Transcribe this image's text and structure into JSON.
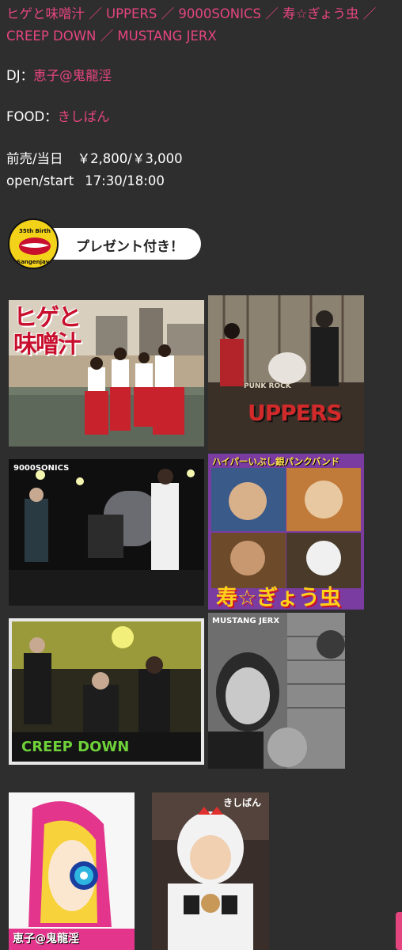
{
  "lineup": {
    "bands": [
      "ヒゲと味噌汁",
      "UPPERS",
      "9000SONICS",
      "寿☆ぎょう虫",
      "CREEP DOWN",
      "MUSTANG JERX"
    ],
    "separator": "／"
  },
  "dj": {
    "label": "DJ：",
    "name": "恵子@鬼龍淫"
  },
  "food": {
    "label": "FOOD：",
    "name": "きしばん"
  },
  "price": {
    "label": "前売/当日",
    "value": "￥2,800/￥3,000"
  },
  "time": {
    "label": "open/start",
    "value": "17:30/18:00"
  },
  "present_badge": {
    "text": "プレゼント付き！",
    "logo_top": "35th Birth",
    "logo_bottom": "Sangenjaya"
  },
  "photos": {
    "higeto": {
      "caption": "ヒゲと味噌汁"
    },
    "uppers": {
      "caption": "UPPERS",
      "subcaption": "PUNK ROCK"
    },
    "sonics": {
      "caption": "9000SONICS"
    },
    "kotobuki": {
      "caption": "寿☆ぎょう虫",
      "top_caption": "ハイパーいぶし銀パンクバンド"
    },
    "creep": {
      "caption": "CREEP DOWN"
    },
    "mustang": {
      "caption": "MUSTANG JERX"
    },
    "keiko": {
      "caption": "恵子@鬼龍淫"
    },
    "kishiban": {
      "caption": "きしばん"
    }
  },
  "colors": {
    "background": "#2e2e2e",
    "accent": "#e5457f",
    "text": "#ffffff"
  }
}
